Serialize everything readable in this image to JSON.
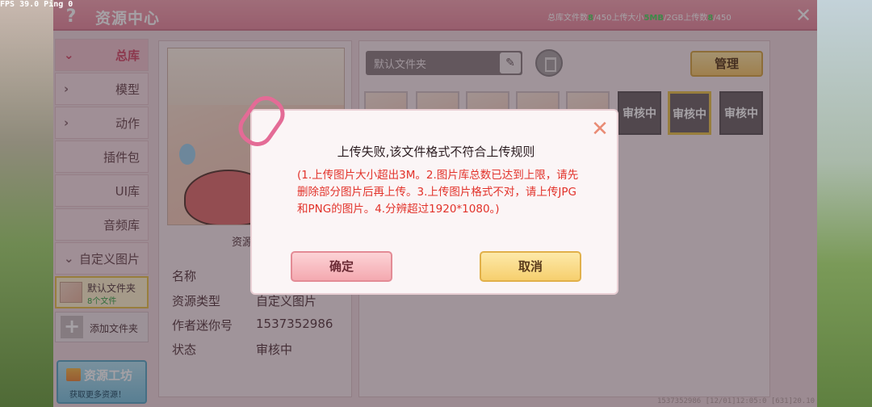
{
  "hud": {
    "fps": "FPS 39.0  Ping 0"
  },
  "window": {
    "title": "资源中心",
    "stats": {
      "files_prefix": "总库文件数",
      "files_used": "8",
      "files_total": "/450",
      "size_prefix": "上传大小",
      "size_used": "5MB",
      "size_total": "/2GB",
      "upload_prefix": "上传数",
      "upload_used": "8",
      "upload_total": "/450"
    }
  },
  "sidebar": {
    "items": [
      {
        "label": "总库",
        "chevron": "⌄"
      },
      {
        "label": "模型",
        "chevron": "›"
      },
      {
        "label": "动作",
        "chevron": "›"
      },
      {
        "label": "插件包",
        "chevron": ""
      },
      {
        "label": "UI库",
        "chevron": ""
      },
      {
        "label": "音频库",
        "chevron": ""
      },
      {
        "label": "自定义图片",
        "chevron": "⌄"
      }
    ],
    "folder": {
      "name": "默认文件夹",
      "count": "8个文件"
    },
    "add_folder": "添加文件夹",
    "workshop": {
      "title": "资源工坊",
      "subtitle": "获取更多资源！"
    }
  },
  "preview": {
    "caption": "资源",
    "fields": [
      {
        "label": "名称",
        "value": ""
      },
      {
        "label": "资源类型",
        "value": "自定义图片"
      },
      {
        "label": "作者迷你号",
        "value": "1537352986"
      },
      {
        "label": "状态",
        "value": "审核中"
      }
    ]
  },
  "library": {
    "folder_select": "默认文件夹",
    "manage_label": "管理",
    "review_label": "审核中"
  },
  "status_bar": "1537352986   [12/01]12:05:0   [631]20.10",
  "dialog": {
    "title": "上传失败,该文件格式不符合上传规则",
    "message": "(1.上传图片大小超出3M。2.图片库总数已达到上限，请先删除部分图片后再上传。3.上传图片格式不对，请上传JPG和PNG的图片。4.分辨超过1920*1080。)",
    "ok_label": "确定",
    "cancel_label": "取消"
  }
}
